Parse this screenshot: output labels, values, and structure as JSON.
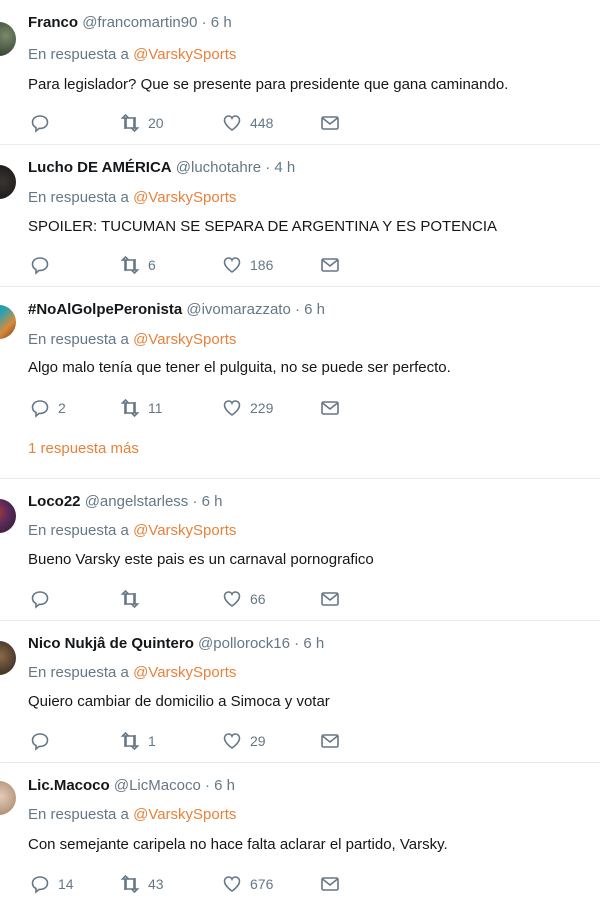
{
  "colors": {
    "accent": "#e8823b",
    "muted": "#657786",
    "text": "#14171a",
    "divider": "#e6ecf0"
  },
  "reply_prefix": "En respuesta a",
  "more_replies_label": "1 respuesta más",
  "tweets": [
    {
      "name": "Franco",
      "handle": "@francomartin90",
      "time": "· 6 h",
      "mention": "@VarskySports",
      "text": "Para legislador? Que se presente para presidente que gana caminando.",
      "replies": "",
      "retweets": "20",
      "likes": "448"
    },
    {
      "name": "Lucho DE AMÉRICA",
      "handle": "@luchotahre",
      "time": "· 4 h",
      "mention": "@VarskySports",
      "text": "SPOILER: TUCUMAN SE SEPARA DE ARGENTINA Y ES POTENCIA",
      "replies": "",
      "retweets": "6",
      "likes": "186"
    },
    {
      "name": "#NoAlGolpePeronista",
      "handle": "@ivomarazzato",
      "time": "· 6 h",
      "mention": "@VarskySports",
      "text": "Algo malo tenía que tener el pulguita, no se puede ser perfecto.",
      "replies": "2",
      "retweets": "11",
      "likes": "229"
    },
    {
      "name": "Loco22",
      "handle": "@angelstarless",
      "time": "· 6 h",
      "mention": "@VarskySports",
      "text": "Bueno Varsky este pais es un carnaval pornografico",
      "replies": "",
      "retweets": "",
      "likes": "66"
    },
    {
      "name": "Nico Nukjâ de Quintero",
      "handle": "@pollorock16",
      "time": "· 6 h",
      "mention": "@VarskySports",
      "text": "Quiero cambiar de domicilio a Simoca y votar",
      "replies": "",
      "retweets": "1",
      "likes": "29"
    },
    {
      "name": "Lic.Macoco",
      "handle": "@LicMacoco",
      "time": "· 6 h",
      "mention": "@VarskySports",
      "text": "Con semejante caripela no hace falta aclarar el partido, Varsky.",
      "replies": "14",
      "retweets": "43",
      "likes": "676"
    }
  ]
}
